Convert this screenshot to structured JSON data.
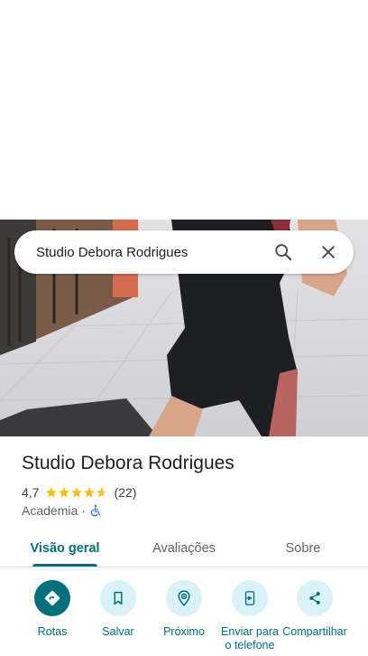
{
  "search": {
    "query": "Studio Debora Rodrigues"
  },
  "place": {
    "name": "Studio Debora Rodrigues",
    "rating": "4,7",
    "stars": 4.7,
    "review_count": "(22)",
    "category": "Academia",
    "separator": "·"
  },
  "tabs": [
    {
      "label": "Visão geral"
    },
    {
      "label": "Avaliações"
    },
    {
      "label": "Sobre"
    }
  ],
  "actions": [
    {
      "label": "Rotas",
      "icon": "directions-icon"
    },
    {
      "label": "Salvar",
      "icon": "bookmark-icon"
    },
    {
      "label": "Próximo",
      "icon": "nearby-icon"
    },
    {
      "label": "Enviar para o telefone",
      "icon": "send-to-phone-icon"
    },
    {
      "label": "Compartilhar",
      "icon": "share-icon"
    }
  ],
  "colors": {
    "accent": "#00707a",
    "accent_light": "#d9f2f5",
    "star": "#fbbc04",
    "accessibility": "#1a73e8"
  }
}
